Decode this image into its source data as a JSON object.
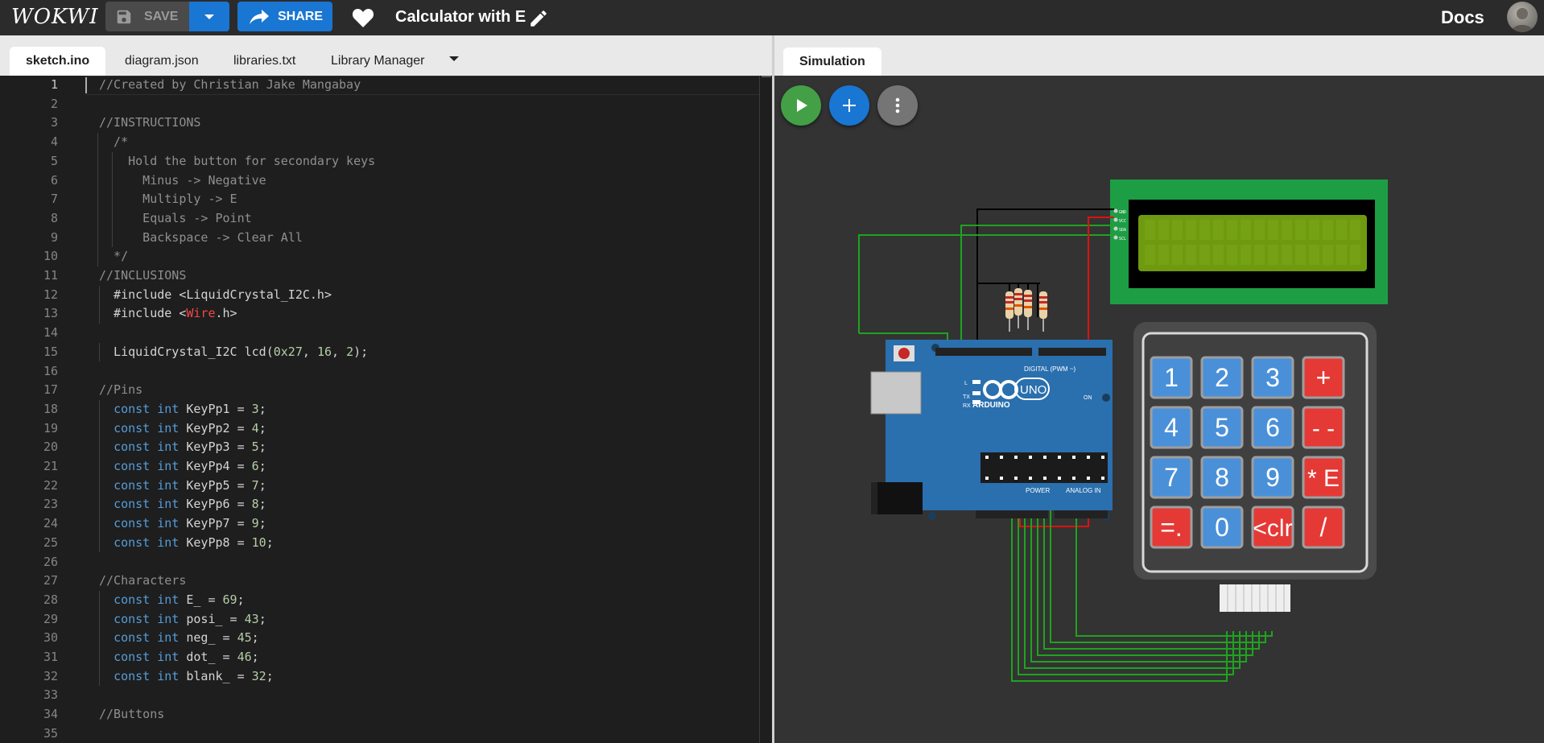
{
  "app": {
    "logo": "WOKWI",
    "save_label": "SAVE",
    "share_label": "SHARE",
    "project_title": "Calculator with E",
    "docs_label": "Docs"
  },
  "editor_tabs": [
    {
      "label": "sketch.ino",
      "active": true
    },
    {
      "label": "diagram.json",
      "active": false
    },
    {
      "label": "libraries.txt",
      "active": false
    },
    {
      "label": "Library Manager",
      "active": false
    }
  ],
  "simulation_tab": {
    "label": "Simulation"
  },
  "editor": {
    "current_line": 1,
    "lines": [
      "//Created by Christian Jake Mangabay",
      "",
      "//INSTRUCTIONS",
      "  /*",
      "    Hold the button for secondary keys",
      "      Minus -> Negative",
      "      Multiply -> E",
      "      Equals -> Point",
      "      Backspace -> Clear All",
      "  */",
      "//INCLUSIONS",
      "  #include <LiquidCrystal_I2C.h>",
      "  #include <Wire.h>",
      "",
      "  LiquidCrystal_I2C lcd(0x27, 16, 2);",
      "",
      "//Pins",
      "  const int KeyPp1 = 3;",
      "  const int KeyPp2 = 4;",
      "  const int KeyPp3 = 5;",
      "  const int KeyPp4 = 6;",
      "  const int KeyPp5 = 7;",
      "  const int KeyPp6 = 8;",
      "  const int KeyPp7 = 9;",
      "  const int KeyPp8 = 10;",
      "",
      "//Characters",
      "  const int E_ = 69;",
      "  const int posi_ = 43;",
      "  const int neg_ = 45;",
      "  const int dot_ = 46;",
      "  const int blank_ = 32;",
      "",
      "//Buttons",
      ""
    ]
  },
  "simulation": {
    "keypad_keys": [
      [
        "1",
        "2",
        "3",
        "+"
      ],
      [
        "4",
        "5",
        "6",
        "- -"
      ],
      [
        "7",
        "8",
        "9",
        "* E"
      ],
      [
        "=.",
        "0",
        "<clr",
        "/"
      ]
    ],
    "arduino": {
      "brand": "ARDUINO",
      "model": "UNO",
      "digital_label": "DIGITAL (PWM ~)",
      "power_label": "POWER",
      "analog_label": "ANALOG IN",
      "on_label": "ON",
      "tx_label": "TX",
      "rx_label": "RX",
      "l_label": "L"
    },
    "lcd_pins": [
      "GND",
      "VCC",
      "SDA",
      "SCL"
    ]
  },
  "colors": {
    "accent": "#1976d2",
    "play": "#43a047",
    "keypad_digit": "#4a90d9",
    "keypad_op": "#e53935",
    "wire_green": "#1fa31f",
    "wire_red": "#e01010",
    "board": "#2a6fae"
  },
  "icons": [
    "save-icon",
    "chevron-down-icon",
    "share-icon",
    "heart-icon",
    "pencil-icon",
    "avatar",
    "play-icon",
    "plus-icon",
    "more-vert-icon"
  ]
}
